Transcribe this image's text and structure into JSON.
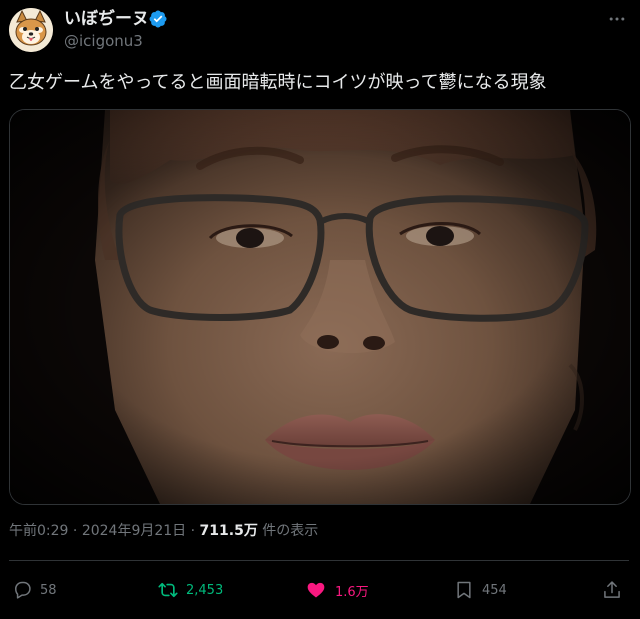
{
  "author": {
    "display_name": "いぼぢーヌ",
    "handle": "@icigonu3",
    "verified": true
  },
  "more_icon": "more-horizontal-icon",
  "tweet": {
    "text": "乙女ゲームをやってると画面暗転時にコイツが映って鬱になる現象"
  },
  "meta": {
    "time": "午前0:29",
    "separator1": " · ",
    "date": "2024年9月21日",
    "separator2": " · ",
    "views": "711.5万",
    "views_suffix": " 件の表示"
  },
  "actions": {
    "reply": {
      "icon": "reply-icon",
      "count": "58"
    },
    "retweet": {
      "icon": "retweet-icon",
      "count": "2,453"
    },
    "like": {
      "icon": "heart-icon",
      "count": "1.6万"
    },
    "bookmark": {
      "icon": "bookmark-icon",
      "count": "454"
    },
    "share": {
      "icon": "share-icon"
    }
  },
  "colors": {
    "background": "#000000",
    "text": "#e7e9ea",
    "muted": "#71767b",
    "retweet": "#00ba7c",
    "like": "#f91880",
    "verified": "#1d9bf0"
  }
}
